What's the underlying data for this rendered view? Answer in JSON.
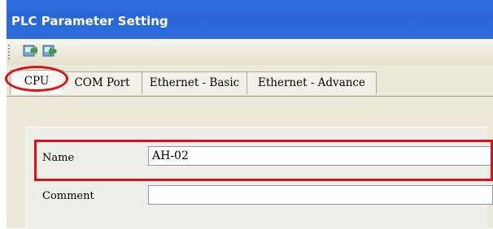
{
  "window": {
    "title": "PLC Parameter Setting"
  },
  "toolbar": {
    "buttons": [
      {
        "icon": "import-icon"
      },
      {
        "icon": "export-icon"
      }
    ]
  },
  "tabs": [
    {
      "label": "CPU",
      "active": true
    },
    {
      "label": "COM Port"
    },
    {
      "label": "Ethernet - Basic"
    },
    {
      "label": "Ethernet - Advance"
    }
  ],
  "form": {
    "name_label": "Name",
    "name_value": "AH-02",
    "comment_label": "Comment",
    "comment_value": ""
  },
  "colors": {
    "titlebar": "#2d6bdc",
    "highlight": "#e0101a",
    "window_bg": "#ece9d8"
  }
}
